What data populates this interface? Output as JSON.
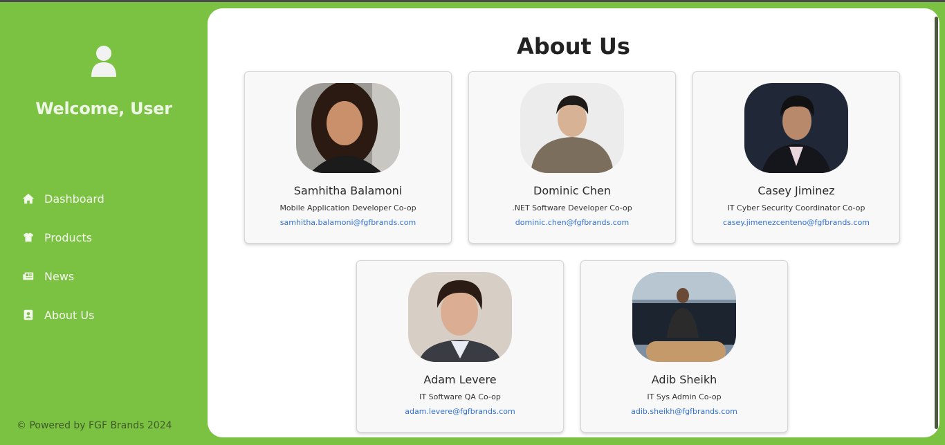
{
  "sidebar": {
    "avatar_icon": "user-icon",
    "welcome": "Welcome, User",
    "items": [
      {
        "label": "Dashboard",
        "icon": "home-icon"
      },
      {
        "label": "Products",
        "icon": "shirt-icon"
      },
      {
        "label": "News",
        "icon": "newspaper-icon"
      },
      {
        "label": "About Us",
        "icon": "contact-book-icon"
      }
    ],
    "footer": "© Powered by FGF Brands 2024"
  },
  "main": {
    "title": "About Us",
    "team": [
      {
        "name": "Samhitha Balamoni",
        "role": "Mobile Application Developer Co-op",
        "email": "samhitha.balamoni@fgfbrands.com"
      },
      {
        "name": "Dominic Chen",
        "role": ".NET Software Developer Co-op",
        "email": "dominic.chen@fgfbrands.com"
      },
      {
        "name": "Casey Jiminez",
        "role": "IT Cyber Security Coordinator Co-op",
        "email": "casey.jimenezcenteno@fgfbrands.com"
      },
      {
        "name": "Adam Levere",
        "role": "IT Software QA Co-op",
        "email": "adam.levere@fgfbrands.com"
      },
      {
        "name": "Adib Sheikh",
        "role": "IT Sys Admin Co-op",
        "email": "adib.sheikh@fgfbrands.com"
      }
    ]
  },
  "colors": {
    "sidebar_bg": "#7cc242",
    "panel_bg": "#ffffff",
    "link": "#2f6fd6",
    "card_bg": "#f8f8f8"
  }
}
